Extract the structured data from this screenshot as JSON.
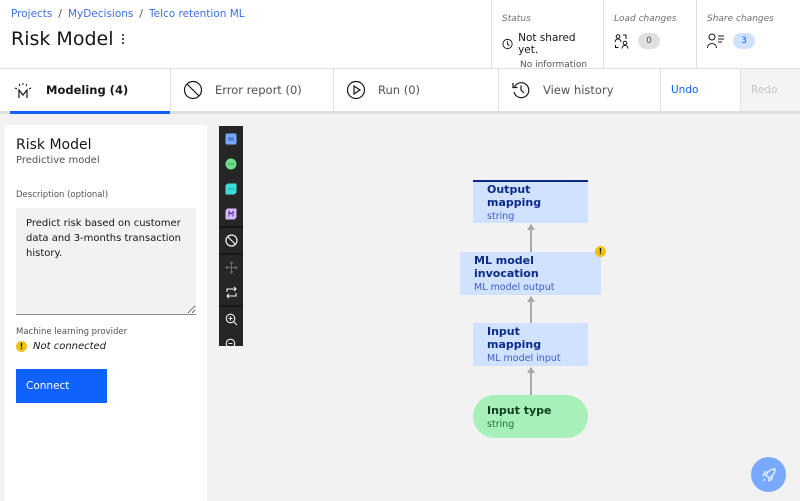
{
  "breadcrumb": [
    {
      "label": "Projects"
    },
    {
      "label": "MyDecisions"
    },
    {
      "label": "Telco retention ML"
    }
  ],
  "breadcrumb_separator": "/",
  "page_title": "Risk Model",
  "header": {
    "status": {
      "label": "Status",
      "value": "Not shared yet.",
      "detail": "No information"
    },
    "load_changes": {
      "label": "Load changes",
      "count": "0"
    },
    "share_changes": {
      "label": "Share changes",
      "count": "3"
    }
  },
  "tabs": {
    "modeling": "Modeling (4)",
    "error_report": "Error report (0)",
    "run": "Run (0)",
    "view_history": "View history",
    "undo": "Undo",
    "redo": "Redo"
  },
  "panel": {
    "name": "Risk Model",
    "type": "Predictive model",
    "description_label": "Description (optional)",
    "description_value": "Predict risk based on customer data and 3-months transaction history.",
    "ml_provider_label": "Machine learning provider",
    "ml_provider_status": "Not connected",
    "connect_label": "Connect"
  },
  "toolbar": {
    "icons": [
      "add-decision-node-icon",
      "add-input-node-icon",
      "add-knowledge-node-icon",
      "add-function-node-icon",
      "delete-icon",
      "move-icon",
      "swap-direction-icon",
      "zoom-in-icon",
      "zoom-out-icon"
    ]
  },
  "diagram": {
    "nodes": [
      {
        "id": "output",
        "title": "Output mapping",
        "subtitle": "string"
      },
      {
        "id": "ml",
        "title": "ML model invocation",
        "subtitle": "ML model output",
        "warning": true
      },
      {
        "id": "input",
        "title": "Input mapping",
        "subtitle": "ML model input"
      },
      {
        "id": "type",
        "title": "Input type",
        "subtitle": "string"
      }
    ],
    "edges": [
      {
        "from": "type",
        "to": "input"
      },
      {
        "from": "input",
        "to": "ml"
      },
      {
        "from": "ml",
        "to": "output"
      }
    ]
  },
  "colors": {
    "accent": "#0f62fe",
    "node_blue": "#d0e2ff",
    "node_green": "#a7f0ba",
    "warning": "#f1c21b"
  }
}
